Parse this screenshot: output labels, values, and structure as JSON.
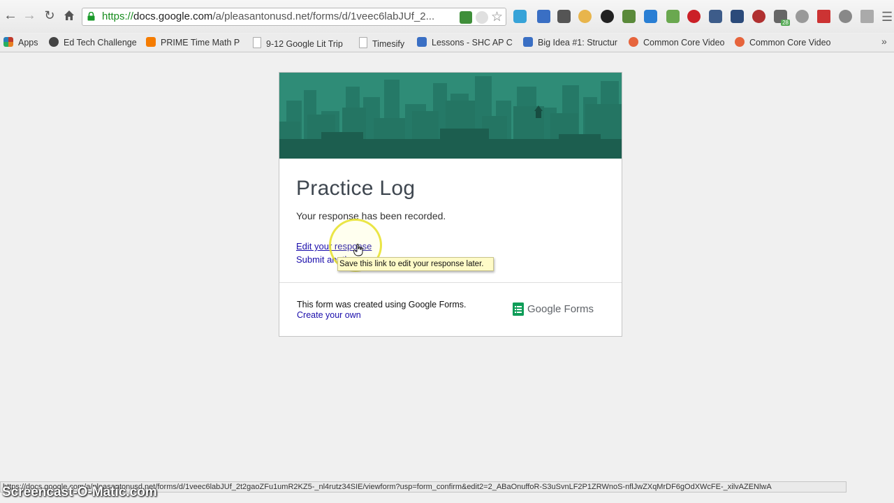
{
  "browser": {
    "url_scheme": "https://",
    "url_host": "docs.google.com",
    "url_path": "/a/pleasantonusd.net/forms/d/1veec6labJUf_2...",
    "status_url": "https://docs.google.com/a/pleasantonusd.net/forms/d/1veec6labJUf_2t2gaoZFu1umR2KZ5-_nl4rutz34SIE/viewform?usp=form_confirm&edit2=2_ABaOnuffoR-S3uSvnLF2P1ZRWnoS-nflJwZXqMrDF6gOdXWcFE-_xilvAZENlwA",
    "extension_count_badge": "28"
  },
  "bookmarks": [
    {
      "label": "Apps",
      "icon": "apps-grid-icon",
      "color": "#c0392b"
    },
    {
      "label": "Ed Tech Challenge",
      "icon": "gear-icon",
      "color": "#444444"
    },
    {
      "label": "PRIME Time Math PU",
      "icon": "blogger-icon",
      "color": "#f57c00"
    },
    {
      "label": "9-12 Google Lit Trip",
      "icon": "page-icon",
      "color": "#ffffff"
    },
    {
      "label": "Timesify",
      "icon": "page-icon",
      "color": "#ffffff"
    },
    {
      "label": "Lessons - SHC AP Ch",
      "icon": "w-icon",
      "color": "#3a6fc4"
    },
    {
      "label": "Big Idea #1: Structur",
      "icon": "w-icon",
      "color": "#3a6fc4"
    },
    {
      "label": "Common Core Video",
      "icon": "gear-icon",
      "color": "#e6643c"
    },
    {
      "label": "Common Core Video",
      "icon": "gear-icon",
      "color": "#e6643c"
    }
  ],
  "form": {
    "title": "Practice Log",
    "confirmation": "Your response has been recorded.",
    "edit_link": "Edit your response",
    "submit_link": "Submit another response",
    "footer_text": "This form was created using Google Forms.",
    "create_link": "Create your own",
    "logo_text": "Google Forms"
  },
  "tooltip": "Save this link to edit your response later.",
  "watermark": "Screencast-O-Matic.com",
  "colors": {
    "banner": "#2f8c77",
    "link": "#1a0dab",
    "forms_green": "#0f9d58"
  }
}
